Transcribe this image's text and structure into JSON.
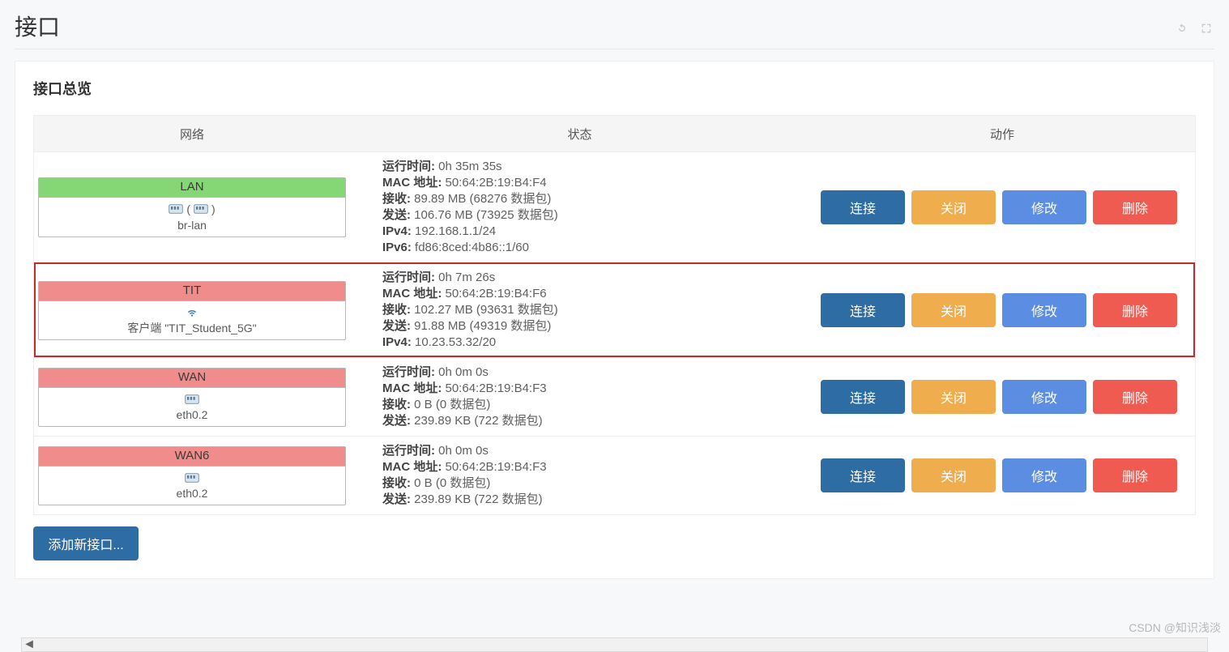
{
  "page": {
    "title": "接口",
    "section_title": "接口总览"
  },
  "table": {
    "headers": {
      "network": "网络",
      "status": "状态",
      "actions": "动作"
    },
    "labels": {
      "uptime": "运行时间:",
      "mac": "MAC 地址:",
      "rx": "接收:",
      "tx": "发送:",
      "ipv4": "IPv4:",
      "ipv6": "IPv6:"
    },
    "action_labels": {
      "connect": "连接",
      "close": "关闭",
      "edit": "修改",
      "delete": "删除"
    },
    "add_button": "添加新接口..."
  },
  "interfaces": [
    {
      "name": "LAN",
      "hdr_color": "green",
      "icon_kind": "bridge",
      "device": "br-lan",
      "highlight": false,
      "status": {
        "uptime": "0h 35m 35s",
        "mac": "50:64:2B:19:B4:F4",
        "rx": "89.89 MB (68276 数据包)",
        "tx": "106.76 MB (73925 数据包)",
        "ipv4": "192.168.1.1/24",
        "ipv6": "fd86:8ced:4b86::1/60"
      }
    },
    {
      "name": "TIT",
      "hdr_color": "red",
      "icon_kind": "wifi",
      "device": "客户端 \"TIT_Student_5G\"",
      "highlight": true,
      "status": {
        "uptime": "0h 7m 26s",
        "mac": "50:64:2B:19:B4:F6",
        "rx": "102.27 MB (93631 数据包)",
        "tx": "91.88 MB (49319 数据包)",
        "ipv4": "10.23.53.32/20"
      }
    },
    {
      "name": "WAN",
      "hdr_color": "red",
      "icon_kind": "port",
      "device": "eth0.2",
      "highlight": false,
      "status": {
        "uptime": "0h 0m 0s",
        "mac": "50:64:2B:19:B4:F3",
        "rx": "0 B (0 数据包)",
        "tx": "239.89 KB (722 数据包)"
      }
    },
    {
      "name": "WAN6",
      "hdr_color": "red",
      "icon_kind": "port",
      "device": "eth0.2",
      "highlight": false,
      "status": {
        "uptime": "0h 0m 0s",
        "mac": "50:64:2B:19:B4:F3",
        "rx": "0 B (0 数据包)",
        "tx": "239.89 KB (722 数据包)"
      }
    }
  ],
  "watermark": "CSDN @知识浅淡"
}
